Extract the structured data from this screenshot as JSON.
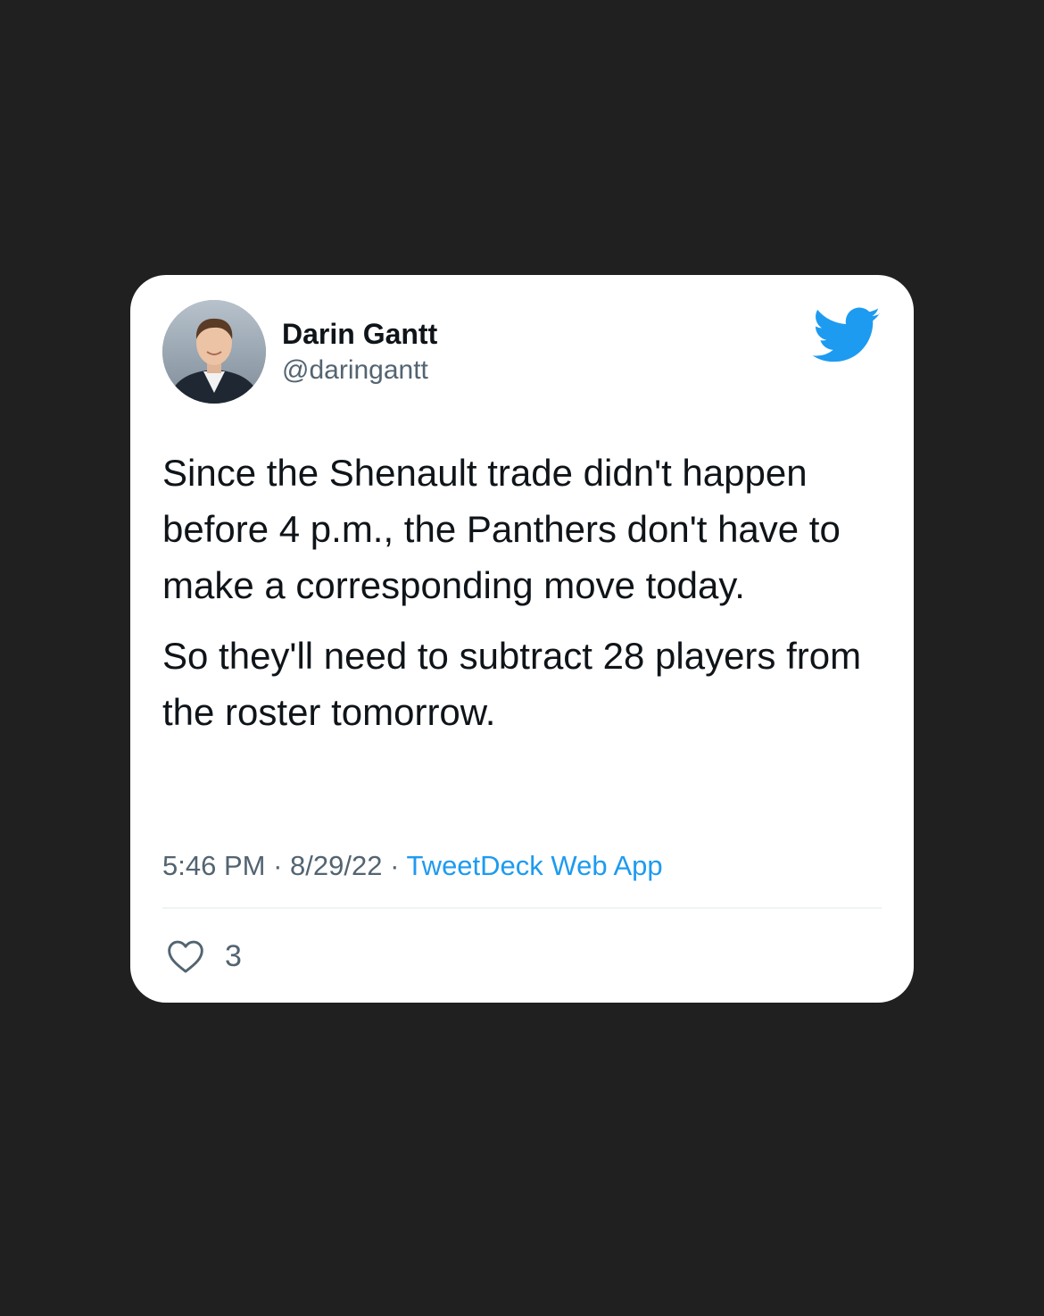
{
  "tweet": {
    "author": {
      "name": "Darin Gantt",
      "handle": "@daringantt"
    },
    "paragraphs": [
      "Since the Shenault trade didn't happen before 4 p.m., the Panthers don't have to make a corresponding move today.",
      "So they'll need to subtract 28 players from the roster tomorrow."
    ],
    "meta": {
      "time": "5:46 PM",
      "separator": " · ",
      "date": "8/29/22",
      "source": "TweetDeck Web App"
    },
    "likes": {
      "count": "3"
    }
  },
  "icons": {
    "brand": "twitter-bird-icon",
    "like": "heart-icon"
  },
  "colors": {
    "background": "#202020",
    "card": "#ffffff",
    "accent": "#1d9bf0",
    "text_primary": "#0f1419",
    "text_secondary": "#536471"
  }
}
